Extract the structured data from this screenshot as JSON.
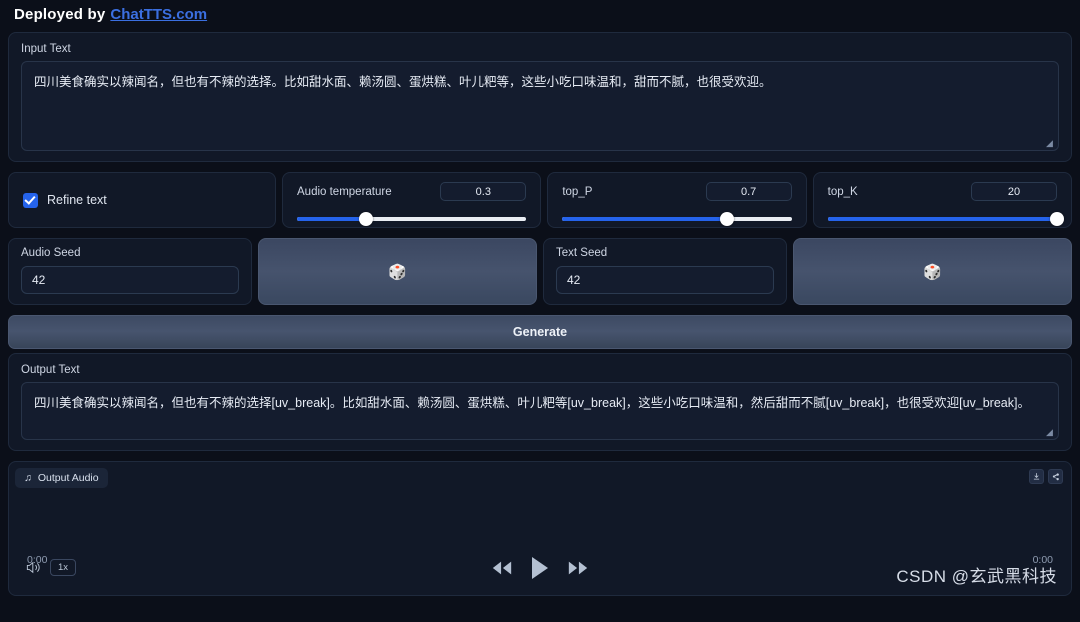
{
  "header": {
    "prefix": "Deployed by",
    "link_label": "ChatTTS.com",
    "link_color": "#3b6fe0"
  },
  "input_section": {
    "label": "Input Text",
    "value": "四川美食确实以辣闻名，但也有不辣的选择。比如甜水面、赖汤圆、蛋烘糕、叶儿粑等，这些小吃口味温和，甜而不腻，也很受欢迎。",
    "placeholder": ""
  },
  "controls": {
    "refine": {
      "label": "Refine text",
      "checked": true,
      "accent": "#2563eb"
    },
    "sliders": [
      {
        "name": "Audio temperature",
        "value": "0.3",
        "percent": 30
      },
      {
        "name": "top_P",
        "value": "0.7",
        "percent": 72
      },
      {
        "name": "top_K",
        "value": "20",
        "percent": 100
      }
    ]
  },
  "seeds": [
    {
      "label": "Audio Seed",
      "value": "42",
      "dice_icon": "dice-icon",
      "dice_glyph": "🎲"
    },
    {
      "label": "Text Seed",
      "value": "42",
      "dice_icon": "dice-icon",
      "dice_glyph": "🎲"
    }
  ],
  "generate": {
    "label": "Generate"
  },
  "output_section": {
    "label": "Output Text",
    "value": "四川美食确实以辣闻名，但也有不辣的选择[uv_break]。比如甜水面、赖汤圆、蛋烘糕、叶儿粑等[uv_break]，这些小吃口味温和，然后甜而不腻[uv_break]，也很受欢迎[uv_break]。"
  },
  "audio": {
    "tab_label": "Output Audio",
    "tab_icon": "music-note-icon",
    "tab_glyph": "♫",
    "download_icon": "download-icon",
    "share_icon": "share-icon",
    "current_time": "0:00",
    "total_time": "0:00",
    "volume_icon": "volume-icon",
    "speed_label": "1x",
    "rewind_icon": "rewind-icon",
    "play_icon": "play-icon",
    "forward_icon": "fast-forward-icon"
  },
  "watermark": {
    "text": "CSDN @玄武黑科技"
  }
}
